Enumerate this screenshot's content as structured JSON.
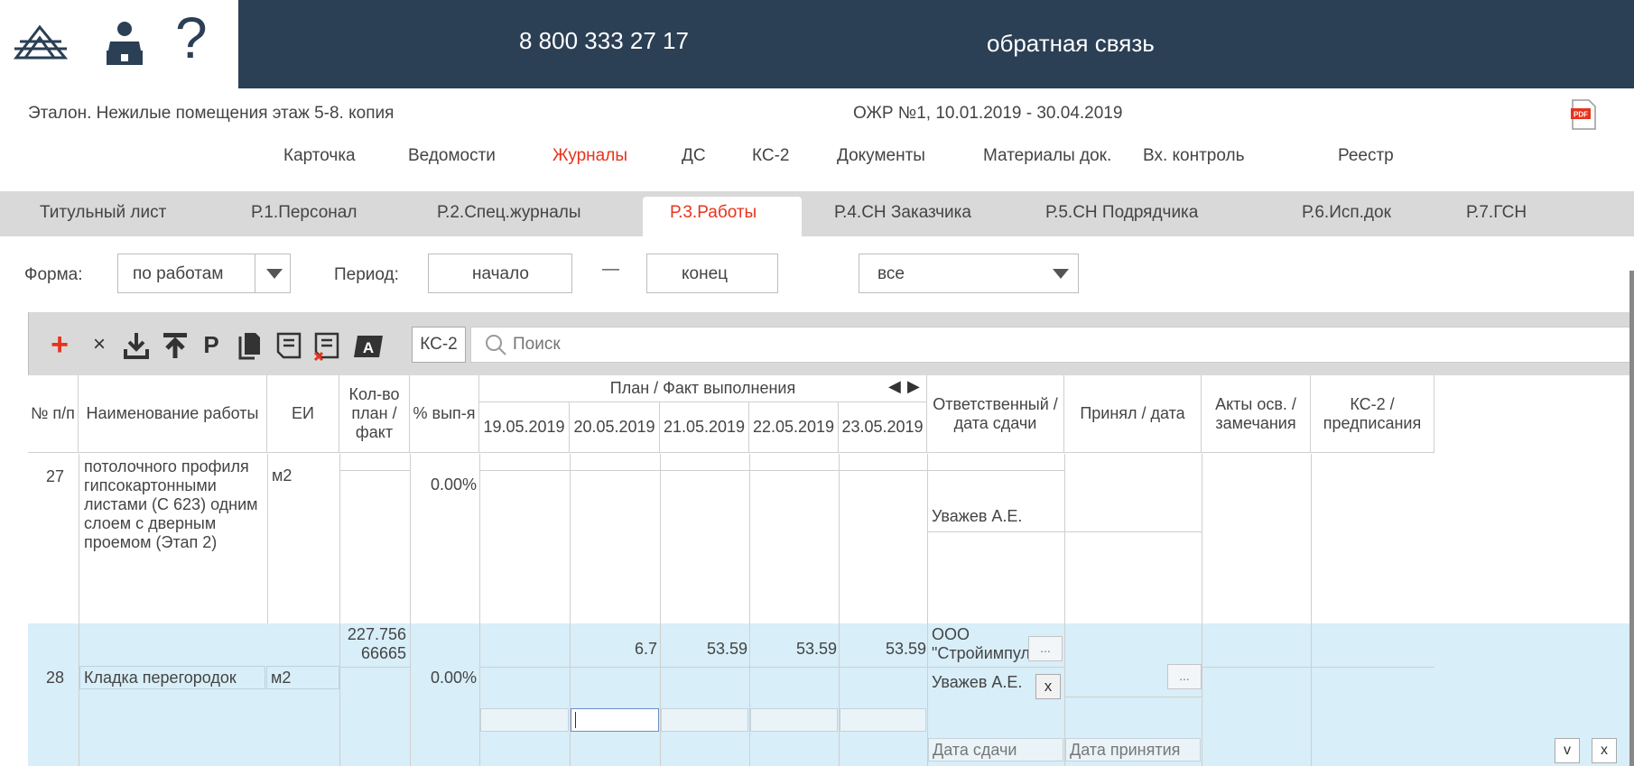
{
  "header": {
    "phone": "8 800 333 27 17",
    "feedback": "обратная связь"
  },
  "project": {
    "title": "Эталон. Нежилые помещения этаж 5-8. копия",
    "ojr": "ОЖР №1, 10.01.2019 - 30.04.2019"
  },
  "mainnav": [
    "Карточка",
    "Ведомости",
    "Журналы",
    "ДС",
    "КС-2",
    "Документы",
    "Материалы док.",
    "Вх. контроль",
    "Реестр"
  ],
  "mainnav_active": "Журналы",
  "subtabs": [
    "Титульный лист",
    "Р.1.Персонал",
    "Р.2.Спец.журналы",
    "Р.3.Работы",
    "Р.4.СН Заказчика",
    "Р.5.СН Подрядчика",
    "Р.6.Исп.док",
    "Р.7.ГСН"
  ],
  "subtab_active": "Р.3.Работы",
  "filters": {
    "form_label": "Форма:",
    "form_value": "по работам",
    "period_label": "Период:",
    "start": "начало",
    "dash": "—",
    "end": "конец",
    "scope": "все"
  },
  "toolbar": {
    "ks2": "КС-2",
    "search_placeholder": "Поиск",
    "p_label": "Р"
  },
  "table": {
    "headers": {
      "num": "№ п/п",
      "name": "Наименование работы",
      "unit": "ЕИ",
      "qty": "Кол-во план / факт",
      "pct": "% вып-я",
      "plan_fact": "План / Факт выполнения",
      "dates": [
        "19.05.2019",
        "20.05.2019",
        "21.05.2019",
        "22.05.2019",
        "23.05.2019"
      ],
      "responsible": "Ответственный / дата сдачи",
      "accepted": "Принял / дата",
      "acts": "Акты осв. / замечания",
      "ks2": "КС-2 / предписания"
    },
    "rows": [
      {
        "num": "27",
        "name": "потолочного профиля гипсокартонными листами (С 623) одним слоем с дверным проемом (Этап 2)",
        "unit": "м2",
        "pct": "0.00%",
        "responsible": "Уважев А.Е."
      },
      {
        "num": "28",
        "name": "Кладка перегородок",
        "unit": "м2",
        "qty": "227.75666665",
        "pct": "0.00%",
        "plan": [
          "",
          "6.7",
          "53.59",
          "53.59",
          "53.59"
        ],
        "responsible_org": "ООО \"Стройимпульс\"",
        "responsible": "Уважев А.Е.",
        "date_submit": "Дата сдачи",
        "date_accept": "Дата принятия",
        "dots": "...",
        "x": "x"
      }
    ]
  },
  "corner": {
    "v": "v",
    "x": "x"
  }
}
